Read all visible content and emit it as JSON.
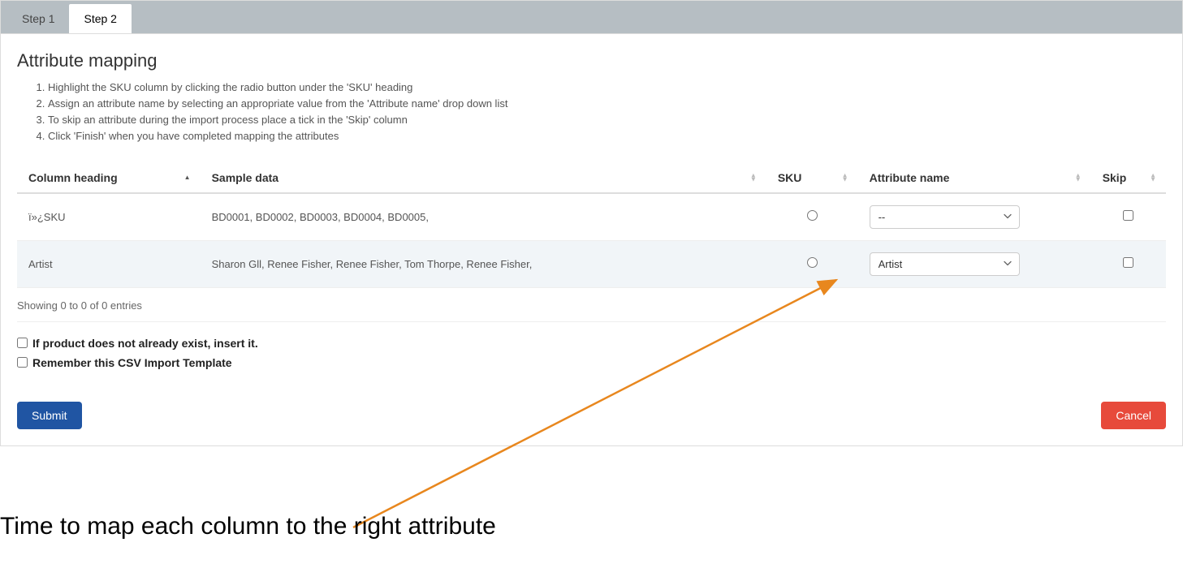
{
  "tabs": [
    {
      "label": "Step 1",
      "active": false
    },
    {
      "label": "Step 2",
      "active": true
    }
  ],
  "page": {
    "title": "Attribute mapping",
    "instructions": [
      "Highlight the SKU column by clicking the radio button under the 'SKU' heading",
      "Assign an attribute name by selecting an appropriate value from the 'Attribute name' drop down list",
      "To skip an attribute during the import process place a tick in the 'Skip' column",
      "Click 'Finish' when you have completed mapping the attributes"
    ]
  },
  "table": {
    "headers": {
      "column_heading": "Column heading",
      "sample_data": "Sample data",
      "sku": "SKU",
      "attribute_name": "Attribute name",
      "skip": "Skip"
    },
    "rows": [
      {
        "column_heading": "ï»¿SKU",
        "sample_data": "BD0001, BD0002, BD0003, BD0004, BD0005,",
        "sku_selected": false,
        "attribute_selected": "--",
        "skip": false
      },
      {
        "column_heading": "Artist",
        "sample_data": "Sharon Gll, Renee Fisher, Renee Fisher, Tom Thorpe, Renee Fisher,",
        "sku_selected": false,
        "attribute_selected": "Artist",
        "skip": false
      }
    ],
    "info": "Showing 0 to 0 of 0 entries"
  },
  "attribute_options": [
    "--",
    "Artist"
  ],
  "options": {
    "insert_if_missing_label": "If product does not already exist, insert it.",
    "insert_if_missing_checked": false,
    "remember_template_label": "Remember this CSV Import Template",
    "remember_template_checked": false
  },
  "buttons": {
    "submit": "Submit",
    "cancel": "Cancel"
  },
  "annotation": {
    "text": "Time to map each column to the right attribute"
  }
}
